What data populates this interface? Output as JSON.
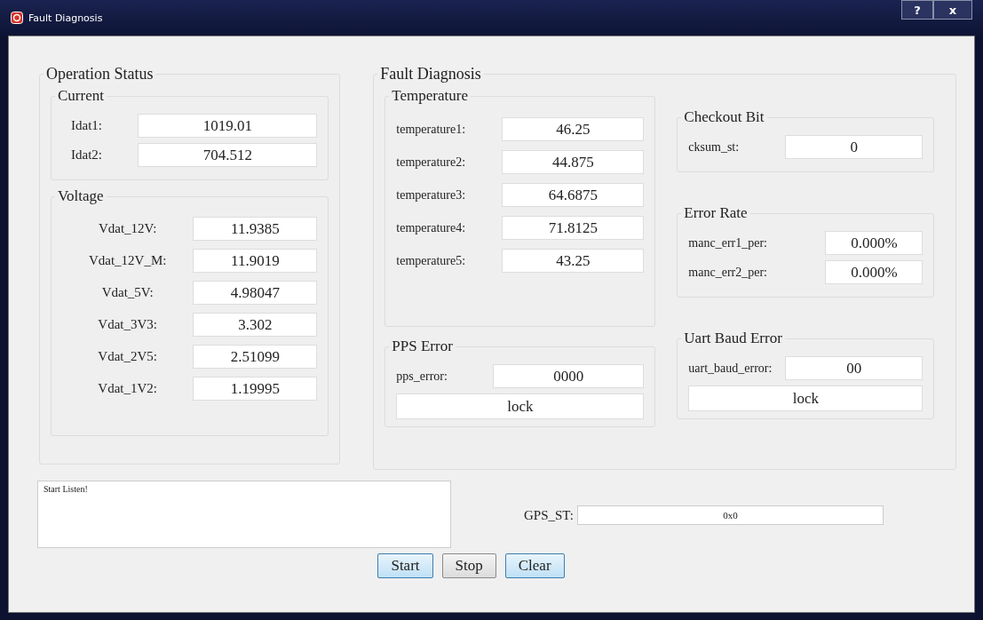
{
  "window": {
    "title": "Fault Diagnosis",
    "title_buttons": [
      "?",
      "x"
    ]
  },
  "operation_status": {
    "title": "Operation Status",
    "current": {
      "title": "Current",
      "fields": [
        {
          "label": "Idat1:",
          "value": "1019.01"
        },
        {
          "label": "Idat2:",
          "value": "704.512"
        }
      ]
    },
    "voltage": {
      "title": "Voltage",
      "fields": [
        {
          "label": "Vdat_12V:",
          "value": "11.9385"
        },
        {
          "label": "Vdat_12V_M:",
          "value": "11.9019"
        },
        {
          "label": "Vdat_5V:",
          "value": "4.98047"
        },
        {
          "label": "Vdat_3V3:",
          "value": "3.302"
        },
        {
          "label": "Vdat_2V5:",
          "value": "2.51099"
        },
        {
          "label": "Vdat_1V2:",
          "value": "1.19995"
        }
      ]
    }
  },
  "fault_diagnosis": {
    "title": "Fault Diagnosis",
    "temperature": {
      "title": "Temperature",
      "fields": [
        {
          "label": "temperature1:",
          "value": "46.25"
        },
        {
          "label": "temperature2:",
          "value": "44.875"
        },
        {
          "label": "temperature3:",
          "value": "64.6875"
        },
        {
          "label": "temperature4:",
          "value": "71.8125"
        },
        {
          "label": "temperature5:",
          "value": "43.25"
        }
      ]
    },
    "checkout_bit": {
      "title": "Checkout Bit",
      "fields": [
        {
          "label": "cksum_st:",
          "value": "0"
        }
      ]
    },
    "error_rate": {
      "title": "Error Rate",
      "fields": [
        {
          "label": "manc_err1_per:",
          "value": "0.000%"
        },
        {
          "label": "manc_err2_per:",
          "value": "0.000%"
        }
      ]
    },
    "pps_error": {
      "title": "PPS Error",
      "fields": [
        {
          "label": "pps_error:",
          "value": "0000"
        }
      ],
      "status": "lock"
    },
    "uart_baud_error": {
      "title": "Uart Baud Error",
      "fields": [
        {
          "label": "uart_baud_error:",
          "value": "00"
        }
      ],
      "status": "lock"
    }
  },
  "log": {
    "text": "Start Listen!"
  },
  "gps": {
    "label": "GPS_ST:",
    "value": "0x0"
  },
  "buttons": [
    {
      "label": "Start",
      "focused": true
    },
    {
      "label": "Stop",
      "focused": false
    },
    {
      "label": "Clear",
      "focused": true
    }
  ]
}
